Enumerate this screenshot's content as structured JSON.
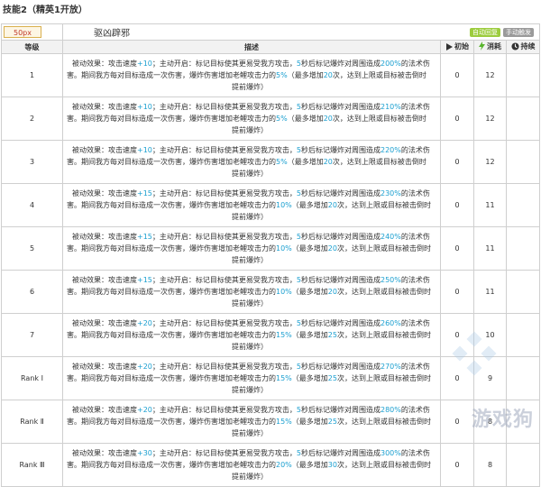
{
  "page_title": "技能2（精英1开放）",
  "skill": {
    "icon_label": "50px",
    "name": "驱凶辟邪",
    "tags": [
      {
        "label": "自动回复",
        "color": "#9ccc3d"
      },
      {
        "label": "手动触发",
        "color": "#9a9a9a"
      }
    ]
  },
  "columns": {
    "level": "等级",
    "description": "描述",
    "initial": "初始",
    "cost": "消耗",
    "duration": "持续"
  },
  "icons": {
    "initial": "play-icon",
    "cost": "lightning-icon",
    "duration": "clock-icon"
  },
  "colors": {
    "highlight": "#1a9fd0",
    "icon_play": "#333333",
    "icon_cost": "#59b52e",
    "icon_clock": "#333333"
  },
  "rows": [
    {
      "level": "1",
      "speed": "+10",
      "p1_mid": "；主动开启：标记目标使其更易受我方攻击，",
      "secs": "5",
      "p1_post": "秒后标记爆炸对周围造成",
      "dmg": "200%",
      "p1_end": "的法术伤",
      "p2_pre": "害。期间我方每对目标造成一次伤害，爆炸伤害增加老鲤攻击力的",
      "inc": "5%",
      "p2_mid": "（最多增加",
      "max": "20",
      "p2_end": "次，达到上限或目标被击倒时",
      "p3": "提前爆炸）",
      "initial": "0",
      "cost": "12",
      "duration": ""
    },
    {
      "level": "2",
      "speed": "+10",
      "p1_mid": "；主动开启：标记目标使其更易受我方攻击，",
      "secs": "5",
      "p1_post": "秒后标记爆炸对周围造成",
      "dmg": "210%",
      "p1_end": "的法术伤",
      "p2_pre": "害。期间我方每对目标造成一次伤害，爆炸伤害增加老鲤攻击力的",
      "inc": "5%",
      "p2_mid": "（最多增加",
      "max": "20",
      "p2_end": "次，达到上限或目标被击倒时",
      "p3": "提前爆炸）",
      "initial": "0",
      "cost": "12",
      "duration": ""
    },
    {
      "level": "3",
      "speed": "+10",
      "p1_mid": "；主动开启：标记目标使其更易受我方攻击，",
      "secs": "5",
      "p1_post": "秒后标记爆炸对周围造成",
      "dmg": "220%",
      "p1_end": "的法术伤",
      "p2_pre": "害。期间我方每对目标造成一次伤害，爆炸伤害增加老鲤攻击力的",
      "inc": "5%",
      "p2_mid": "（最多增加",
      "max": "20",
      "p2_end": "次，达到上限或目标被击倒时",
      "p3": "提前爆炸）",
      "initial": "0",
      "cost": "12",
      "duration": ""
    },
    {
      "level": "4",
      "speed": "+15",
      "p1_mid": "；主动开启：标记目标使其更易受我方攻击，",
      "secs": "5",
      "p1_post": "秒后标记爆炸对周围造成",
      "dmg": "230%",
      "p1_end": "的法术伤",
      "p2_pre": "害。期间我方每对目标造成一次伤害，爆炸伤害增加老鲤攻击力的",
      "inc": "10%",
      "p2_mid": "（最多增加",
      "max": "20",
      "p2_end": "次，达到上限或目标被击倒时",
      "p3": "提前爆炸）",
      "initial": "0",
      "cost": "11",
      "duration": ""
    },
    {
      "level": "5",
      "speed": "+15",
      "p1_mid": "；主动开启：标记目标使其更易受我方攻击，",
      "secs": "5",
      "p1_post": "秒后标记爆炸对周围造成",
      "dmg": "240%",
      "p1_end": "的法术伤",
      "p2_pre": "害。期间我方每对目标造成一次伤害，爆炸伤害增加老鲤攻击力的",
      "inc": "10%",
      "p2_mid": "（最多增加",
      "max": "20",
      "p2_end": "次，达到上限或目标被击倒时",
      "p3": "提前爆炸）",
      "initial": "0",
      "cost": "11",
      "duration": ""
    },
    {
      "level": "6",
      "speed": "+15",
      "p1_mid": "；主动开启：标记目标使其更易受我方攻击，",
      "secs": "5",
      "p1_post": "秒后标记爆炸对周围造成",
      "dmg": "250%",
      "p1_end": "的法术伤",
      "p2_pre": "害。期间我方每对目标造成一次伤害，爆炸伤害增加老鲤攻击力的",
      "inc": "10%",
      "p2_mid": "（最多增加",
      "max": "20",
      "p2_end": "次，达到上限或目标被击倒时",
      "p3": "提前爆炸）",
      "initial": "0",
      "cost": "11",
      "duration": ""
    },
    {
      "level": "7",
      "speed": "+20",
      "p1_mid": "；主动开启：标记目标使其更易受我方攻击，",
      "secs": "5",
      "p1_post": "秒后标记爆炸对周围造成",
      "dmg": "260%",
      "p1_end": "的法术伤",
      "p2_pre": "害。期间我方每对目标造成一次伤害，爆炸伤害增加老鲤攻击力的",
      "inc": "15%",
      "p2_mid": "（最多增加",
      "max": "25",
      "p2_end": "次，达到上限或目标被击倒时",
      "p3": "提前爆炸）",
      "initial": "0",
      "cost": "10",
      "duration": ""
    },
    {
      "level": "Rank Ⅰ",
      "speed": "+20",
      "p1_mid": "；主动开启：标记目标使其更易受我方攻击，",
      "secs": "5",
      "p1_post": "秒后标记爆炸对周围造成",
      "dmg": "270%",
      "p1_end": "的法术伤",
      "p2_pre": "害。期间我方每对目标造成一次伤害，爆炸伤害增加老鲤攻击力的",
      "inc": "15%",
      "p2_mid": "（最多增加",
      "max": "25",
      "p2_end": "次，达到上限或目标被击倒时",
      "p3": "提前爆炸）",
      "initial": "0",
      "cost": "9",
      "duration": ""
    },
    {
      "level": "Rank Ⅱ",
      "speed": "+20",
      "p1_mid": "；主动开启：标记目标使其更易受我方攻击，",
      "secs": "5",
      "p1_post": "秒后标记爆炸对周围造成",
      "dmg": "280%",
      "p1_end": "的法术伤",
      "p2_pre": "害。期间我方每对目标造成一次伤害，爆炸伤害增加老鲤攻击力的",
      "inc": "15%",
      "p2_mid": "（最多增加",
      "max": "25",
      "p2_end": "次，达到上限或目标被击倒时",
      "p3": "提前爆炸）",
      "initial": "0",
      "cost": "8",
      "duration": ""
    },
    {
      "level": "Rank Ⅲ",
      "speed": "+30",
      "p1_mid": "；主动开启：标记目标使其更易受我方攻击，",
      "secs": "5",
      "p1_post": "秒后标记爆炸对周围造成",
      "dmg": "300%",
      "p1_end": "的法术伤",
      "p2_pre": "害。期间我方每对目标造成一次伤害，爆炸伤害增加老鲤攻击力的",
      "inc": "20%",
      "p2_mid": "（最多增加",
      "max": "30",
      "p2_end": "次，达到上限或目标被击倒时",
      "p3": "提前爆炸）",
      "initial": "0",
      "cost": "8",
      "duration": ""
    }
  ],
  "passive_label": "被动效果：攻击速度",
  "watermark": "游戏狗"
}
